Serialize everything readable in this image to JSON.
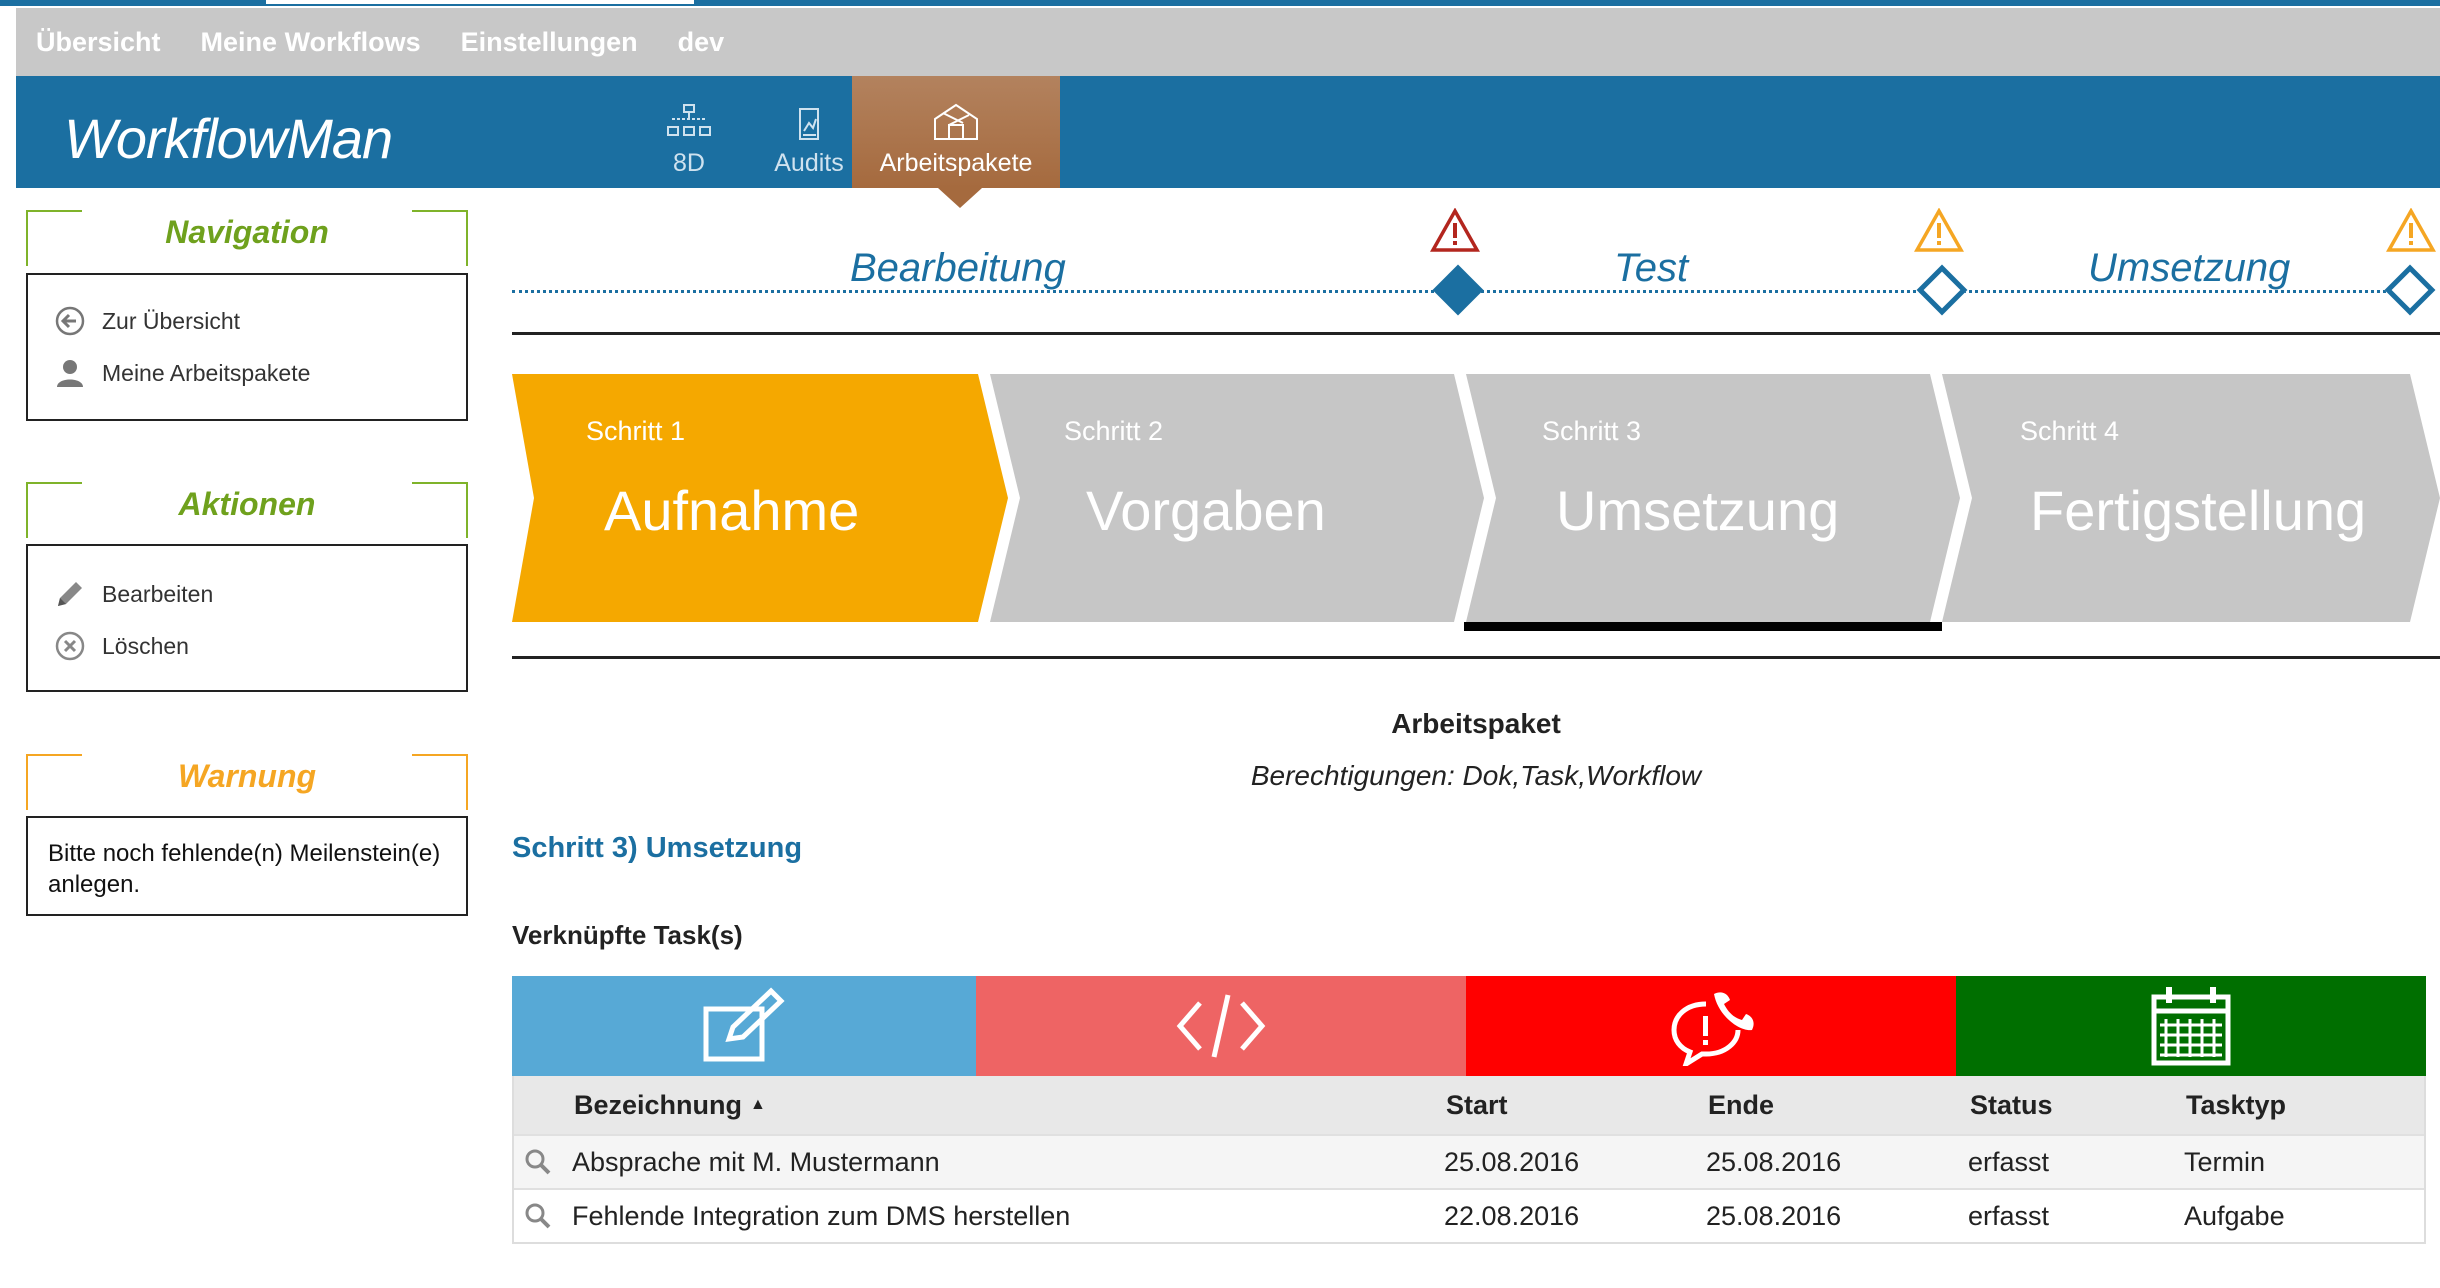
{
  "topmenu": [
    "Übersicht",
    "Meine Workflows",
    "Einstellungen",
    "dev"
  ],
  "brand": "WorkflowMan",
  "module_tabs": [
    {
      "label": "8D",
      "icon": "8d-tree-icon",
      "active": false
    },
    {
      "label": "Audits",
      "icon": "audit-chart-icon",
      "active": false
    },
    {
      "label": "Arbeitspakete",
      "icon": "package-house-icon",
      "active": true
    }
  ],
  "sidebar": {
    "navigation": {
      "title": "Navigation",
      "items": [
        {
          "label": "Zur Übersicht",
          "icon": "arrow-left-circle-icon"
        },
        {
          "label": "Meine Arbeitspakete",
          "icon": "user-icon"
        }
      ]
    },
    "actions": {
      "title": "Aktionen",
      "items": [
        {
          "label": "Bearbeiten",
          "icon": "pencil-icon"
        },
        {
          "label": "Löschen",
          "icon": "x-circle-icon"
        }
      ]
    },
    "warning": {
      "title": "Warnung",
      "text": "Bitte noch fehlende(n) Meilenstein(e) anlegen."
    }
  },
  "phases": [
    {
      "label": "Bearbeitung",
      "milestone": "filled",
      "warning_color": "#b3261e"
    },
    {
      "label": "Test",
      "milestone": "open",
      "warning_color": "#f5a623"
    },
    {
      "label": "Umsetzung",
      "milestone": "open",
      "warning_color": "#f5a623"
    }
  ],
  "steps": [
    {
      "num": "Schritt 1",
      "name": "Aufnahme",
      "color": "#f5a800",
      "active": true
    },
    {
      "num": "Schritt 2",
      "name": "Vorgaben",
      "color": "#c6c6c6",
      "active": false
    },
    {
      "num": "Schritt 3",
      "name": "Umsetzung",
      "color": "#c6c6c6",
      "active": false
    },
    {
      "num": "Schritt 4",
      "name": "Fertigstellung",
      "color": "#c6c6c6",
      "active": false
    }
  ],
  "content": {
    "title": "Arbeitspaket",
    "permissions": "Berechtigungen: Dok,Task,Workflow",
    "step_heading": "Schritt 3) Umsetzung",
    "tasks_heading": "Verknüpfte Task(s)"
  },
  "task_type_buttons": [
    {
      "icon": "edit-note-icon",
      "color": "#57a9d6"
    },
    {
      "icon": "code-icon",
      "color": "#ee6464"
    },
    {
      "icon": "phone-alert-icon",
      "color": "#ff0000"
    },
    {
      "icon": "calendar-icon",
      "color": "#006f00"
    }
  ],
  "table": {
    "columns": [
      "Bezeichnung",
      "Start",
      "Ende",
      "Status",
      "Tasktyp"
    ],
    "sort_indicator": "▲",
    "rows": [
      {
        "name": "Absprache mit M. Mustermann",
        "start": "25.08.2016",
        "end": "25.08.2016",
        "status": "erfasst",
        "type": "Termin"
      },
      {
        "name": "Fehlende Integration zum DMS herstellen",
        "start": "22.08.2016",
        "end": "25.08.2016",
        "status": "erfasst",
        "type": "Aufgabe"
      }
    ]
  },
  "colors": {
    "header_blue": "#1b6fa1",
    "accent_green": "#6fa11d",
    "accent_orange": "#f5a623",
    "active_step": "#f5a800",
    "inactive_step": "#c6c6c6",
    "active_tab": "#a56a3e"
  }
}
